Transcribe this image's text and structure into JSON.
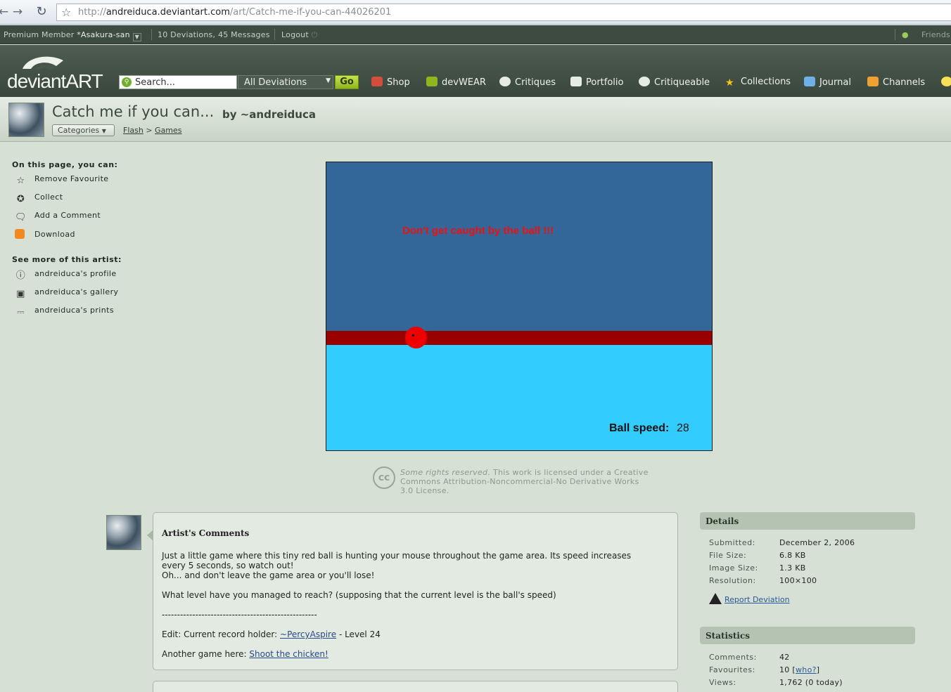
{
  "browser": {
    "url_prefix": "http://",
    "url_host": "andreiduca.deviantart.com",
    "url_path": "/art/Catch-me-if-you-can-44026201"
  },
  "member_bar": {
    "membership": "Premium Member",
    "username": "*Asakura-san",
    "deviations": "10 Deviations,",
    "messages": "45 Messages",
    "logout": "Logout",
    "friends": "Friends"
  },
  "header": {
    "logo_text": "deviantART",
    "search_placeholder": "Search...",
    "search_scope": "All Deviations",
    "go_label": "Go",
    "nav": [
      {
        "label": "Shop",
        "icon": "shop-icon",
        "color": "#d44c3c"
      },
      {
        "label": "devWEAR",
        "icon": "shirt-icon",
        "color": "#8fb61c"
      },
      {
        "label": "Critiques",
        "icon": "critique-icon",
        "color": "#e6ece4"
      },
      {
        "label": "Portfolio",
        "icon": "portfolio-icon",
        "color": "#e6ece4"
      },
      {
        "label": "Critiqueable",
        "icon": "critiqueable-icon",
        "color": "#e6ece4"
      },
      {
        "label": "Collections",
        "icon": "star-icon",
        "color": "#f5c518"
      },
      {
        "label": "Journal",
        "icon": "journal-icon",
        "color": "#6fb0e6"
      },
      {
        "label": "Channels",
        "icon": "tv-icon",
        "color": "#f0a030"
      }
    ]
  },
  "deviation": {
    "title": "Catch me if you can...",
    "by": "by ~andreiduca",
    "categories_label": "Categories",
    "crumb_1": "Flash",
    "crumb_sep": ">",
    "crumb_2": "Games"
  },
  "sidebar": {
    "on_this_page": "On this page, you can:",
    "actions": [
      {
        "label": "Remove Favourite",
        "icon": "star-outline-icon"
      },
      {
        "label": "Collect",
        "icon": "collect-icon"
      },
      {
        "label": "Add a Comment",
        "icon": "comment-icon"
      },
      {
        "label": "Download",
        "icon": "download-icon"
      }
    ],
    "see_more": "See more of this artist:",
    "artist_links": [
      {
        "label": "andreiduca's profile",
        "icon": "info-icon"
      },
      {
        "label": "andreiduca's gallery",
        "icon": "gallery-icon"
      },
      {
        "label": "andreiduca's prints",
        "icon": "prints-icon"
      }
    ]
  },
  "game": {
    "message": "Don't get caught by the ball !!!",
    "speed_label": "Ball speed:",
    "speed_value": "28",
    "colors": {
      "top": "#336699",
      "band": "#990000",
      "bottom": "#33ccff",
      "ball": "#ee0000"
    }
  },
  "license": {
    "badge": "cc",
    "rights": "Some rights reserved.",
    "text": "This work is licensed under a Creative Commons Attribution-Noncommercial-No Derivative Works 3.0 License."
  },
  "artist_comments": {
    "title": "Artist's Comments",
    "line1": "Just a little game where this tiny red ball is hunting your mouse throughout the game area. Its speed increases",
    "line2": "every 5 seconds, so watch out!",
    "line3": "Oh... and don't leave the game area or you'll lose!",
    "line4": "What level have you managed to reach? (supposing that the current level is the ball's speed)",
    "divider": "---------------------------------------------------",
    "record_prefix": "Edit: Current record holder:",
    "record_holder": "~PercyAspire",
    "record_suffix": "- Level 24",
    "another_prefix": "Another game here:",
    "another_link": "Shoot the chicken!"
  },
  "details": {
    "heading": "Details",
    "rows": [
      {
        "key": "Submitted:",
        "value": "December 2, 2006"
      },
      {
        "key": "File Size:",
        "value": "6.8 KB"
      },
      {
        "key": "Image Size:",
        "value": "1.3 KB"
      },
      {
        "key": "Resolution:",
        "value": "100×100"
      }
    ],
    "report": "Report Deviation"
  },
  "statistics": {
    "heading": "Statistics",
    "comments_key": "Comments:",
    "comments_val": "42",
    "favourites_key": "Favourites:",
    "favourites_val": "10",
    "favourites_link": "who?",
    "views_key": "Views:",
    "views_val": "1,762 (0 today)"
  }
}
